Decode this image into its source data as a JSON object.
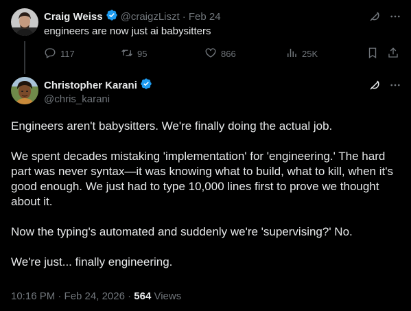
{
  "parent_tweet": {
    "author_name": "Craig Weiss",
    "handle": "@craigzLiszt",
    "date": "· Feb 24",
    "text": "engineers are now just ai babysitters",
    "stats": {
      "replies": "117",
      "retweets": "95",
      "likes": "866",
      "views": "25K"
    },
    "icons": [
      "reply-icon",
      "retweet-icon",
      "like-icon",
      "views-icon",
      "bookmark-icon",
      "share-icon",
      "grok-icon",
      "more-icon"
    ]
  },
  "main_tweet": {
    "author_name": "Christopher Karani",
    "handle": "@chris_karani",
    "paragraphs": [
      "Engineers aren't babysitters. We're finally doing the actual job.",
      "We spent decades mistaking 'implementation' for 'engineering.' The hard part was never syntax—it was knowing what to build, what to kill, when it's good enough. We just had to type 10,000 lines first to prove we thought about it.",
      "Now the typing's automated and suddenly we're 'supervising?' No.",
      "We're just... finally engineering."
    ],
    "timestamp": "10:16 PM · Feb 24, 2026 · ",
    "views_count": "564",
    "views_label": " Views",
    "icons": [
      "grok-icon",
      "more-icon"
    ]
  },
  "colors": {
    "background": "#000000",
    "primary_text": "#e7e9ea",
    "secondary_text": "#71767b",
    "verified_blue": "#1d9bf0",
    "thread_line": "#333639"
  }
}
